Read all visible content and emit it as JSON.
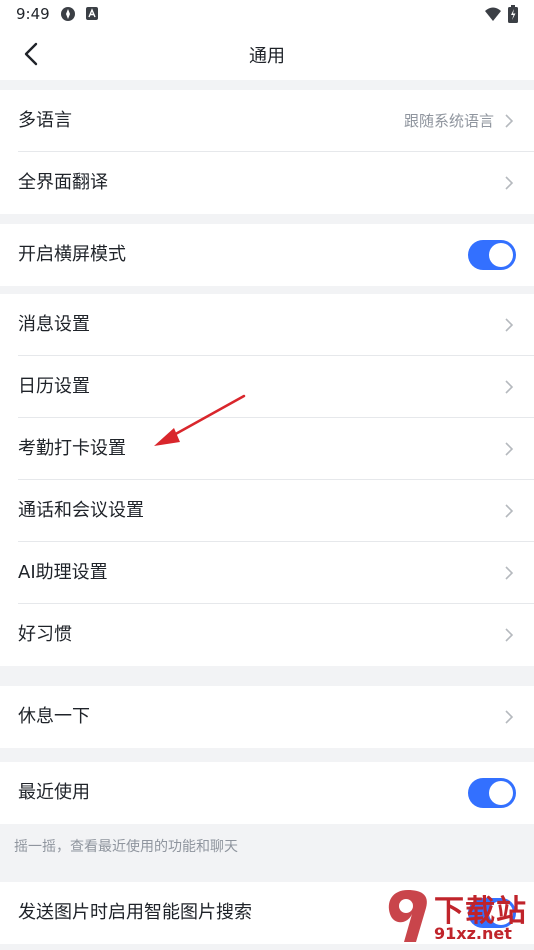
{
  "status_bar": {
    "time": "9:49"
  },
  "nav": {
    "title": "通用"
  },
  "groups": [
    {
      "items": [
        {
          "label": "多语言",
          "value": "跟随系统语言"
        },
        {
          "label": "全界面翻译"
        }
      ]
    },
    {
      "items": [
        {
          "label": "开启横屏模式",
          "toggle": true
        }
      ]
    },
    {
      "items": [
        {
          "label": "消息设置"
        },
        {
          "label": "日历设置"
        },
        {
          "label": "考勤打卡设置"
        },
        {
          "label": "通话和会议设置"
        },
        {
          "label": "AI助理设置"
        },
        {
          "label": "好习惯"
        }
      ]
    },
    {
      "items": [
        {
          "label": "休息一下"
        }
      ]
    },
    {
      "items": [
        {
          "label": "最近使用",
          "toggle": true
        }
      ],
      "hint": "摇一摇，查看最近使用的功能和聊天"
    },
    {
      "items": [
        {
          "label": "发送图片时启用智能图片搜索",
          "toggle": true
        }
      ]
    }
  ],
  "watermark": {
    "main": "下载站",
    "sub": "91xz.net"
  },
  "colors": {
    "accent": "#3370ff",
    "arrow": "#d9262c",
    "background": "#f2f3f5"
  }
}
